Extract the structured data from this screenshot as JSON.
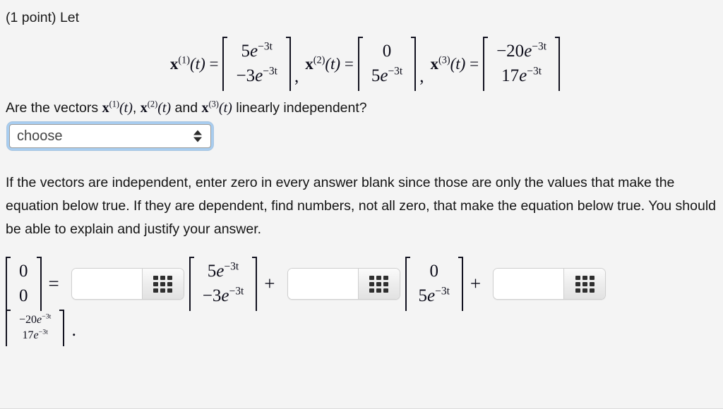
{
  "header": {
    "points_label": "(1 point) Let"
  },
  "definitions": {
    "vectors": [
      {
        "name_base": "x",
        "name_sup": "(1)",
        "arg": "(t)",
        "equals": "=",
        "rows": [
          {
            "coef": "5",
            "base": "e",
            "exp": "−3t"
          },
          {
            "coef": "−3",
            "base": "e",
            "exp": "−3t"
          }
        ]
      },
      {
        "name_base": "x",
        "name_sup": "(2)",
        "arg": "(t)",
        "equals": "=",
        "rows": [
          {
            "coef": "0",
            "base": "",
            "exp": ""
          },
          {
            "coef": "5",
            "base": "e",
            "exp": "−3t"
          }
        ]
      },
      {
        "name_base": "x",
        "name_sup": "(3)",
        "arg": "(t)",
        "equals": "=",
        "rows": [
          {
            "coef": "−20",
            "base": "e",
            "exp": "−3t"
          },
          {
            "coef": "17",
            "base": "e",
            "exp": "−3t"
          }
        ]
      }
    ],
    "separator": ","
  },
  "question": {
    "text_before": "Are the vectors ",
    "v1_base": "x",
    "v1_sup": "(1)",
    "v1_arg": "(t)",
    "sep1": ",  ",
    "v2_base": "x",
    "v2_sup": "(2)",
    "v2_arg": "(t)",
    "sep2": " and ",
    "v3_base": "x",
    "v3_sup": "(3)",
    "v3_arg": "(t)",
    "text_after": " linearly independent?"
  },
  "select": {
    "value": "choose",
    "options": [
      "choose"
    ]
  },
  "instructions": {
    "paragraph": "If the vectors are independent, enter zero in every answer blank since those are only the values that make the equation below true. If they are dependent, find numbers, not all zero, that make the equation below true. You should be able to explain and justify your answer."
  },
  "answer_equation": {
    "lhs": {
      "rows": [
        {
          "coef": "0",
          "base": "",
          "exp": ""
        },
        {
          "coef": "0",
          "base": "",
          "exp": ""
        }
      ]
    },
    "equals": "=",
    "plus": "+",
    "terms": [
      {
        "input_value": "",
        "input_placeholder": "",
        "keypad_icon": "keypad-grid-icon",
        "vector": {
          "rows": [
            {
              "coef": "5",
              "base": "e",
              "exp": "−3t"
            },
            {
              "coef": "−3",
              "base": "e",
              "exp": "−3t"
            }
          ]
        }
      },
      {
        "input_value": "",
        "input_placeholder": "",
        "keypad_icon": "keypad-grid-icon",
        "vector": {
          "rows": [
            {
              "coef": "0",
              "base": "",
              "exp": ""
            },
            {
              "coef": "5",
              "base": "e",
              "exp": "−3t"
            }
          ]
        }
      },
      {
        "input_value": "",
        "input_placeholder": "",
        "keypad_icon": "keypad-grid-icon",
        "vector": {
          "rows": [
            {
              "coef": "−20",
              "base": "e",
              "exp": "−3t"
            },
            {
              "coef": "17",
              "base": "e",
              "exp": "−3t"
            }
          ]
        }
      }
    ],
    "trailing_period": "."
  },
  "colors": {
    "page_background": "#f4f4f4",
    "text": "#141414",
    "math_text": "#0d0d1a",
    "focus_ring": "#a8cdf0",
    "input_border": "#cfcfcf",
    "keypad_dot": "#2f2f2f"
  }
}
